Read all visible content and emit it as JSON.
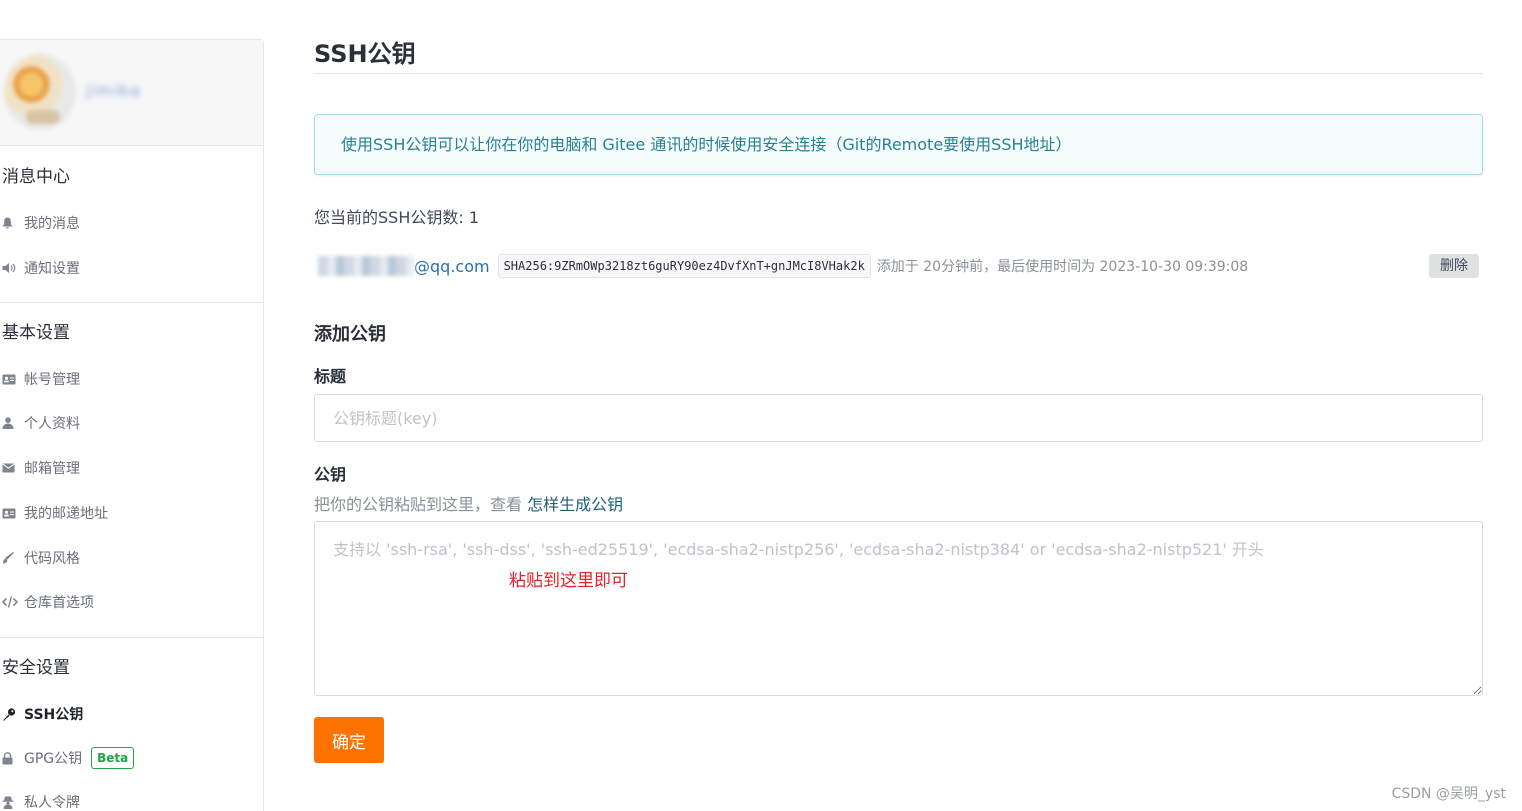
{
  "sidebar": {
    "profile_name": "jimiba",
    "sections": {
      "messages": {
        "title": "消息中心",
        "items": [
          {
            "label": "我的消息",
            "icon": "bell-icon"
          },
          {
            "label": "通知设置",
            "icon": "speaker-icon"
          }
        ]
      },
      "basic": {
        "title": "基本设置",
        "items": [
          {
            "label": "帐号管理",
            "icon": "id-card-icon"
          },
          {
            "label": "个人资料",
            "icon": "user-icon"
          },
          {
            "label": "邮箱管理",
            "icon": "envelope-icon"
          },
          {
            "label": "我的邮递地址",
            "icon": "address-card-icon"
          },
          {
            "label": "代码风格",
            "icon": "brush-icon"
          },
          {
            "label": "仓库首选项",
            "icon": "code-icon"
          }
        ]
      },
      "security": {
        "title": "安全设置",
        "items": [
          {
            "label": "SSH公钥",
            "icon": "key-icon",
            "active": true
          },
          {
            "label": "GPG公钥",
            "icon": "lock-icon",
            "badge": "Beta"
          },
          {
            "label": "私人令牌",
            "icon": "secret-icon"
          }
        ]
      }
    }
  },
  "main": {
    "title": "SSH公钥",
    "info": "使用SSH公钥可以让你在你的电脑和 Gitee 通讯的时候使用安全连接（Git的Remote要使用SSH地址）",
    "key_count": "您当前的SSH公钥数: 1",
    "key": {
      "email_domain": "@qq.com",
      "fingerprint": "SHA256:9ZRmOWp3218zt6guRY90ez4DvfXnT+gnJMcI8VHak2k",
      "meta": "添加于 20分钟前，最后使用时间为 2023-10-30 09:39:08",
      "delete_label": "删除"
    },
    "add": {
      "heading": "添加公钥",
      "title_label": "标题",
      "title_placeholder": "公钥标题(key)",
      "key_label": "公钥",
      "hint_prefix": "把你的公钥粘贴到这里，查看 ",
      "hint_link": "怎样生成公钥",
      "key_placeholder": "支持以 'ssh-rsa', 'ssh-dss', 'ssh-ed25519', 'ecdsa-sha2-nistp256', 'ecdsa-sha2-nistp384' or 'ecdsa-sha2-nistp521' 开头",
      "annotation": "粘贴到这里即可",
      "confirm_label": "确定"
    }
  },
  "watermark": "CSDN @吴明_yst",
  "colors": {
    "accent": "#fe7300",
    "info_bg": "#f4fcfd",
    "info_text": "#2a7f93",
    "beta": "#22a447",
    "annotation": "#e0242c"
  }
}
